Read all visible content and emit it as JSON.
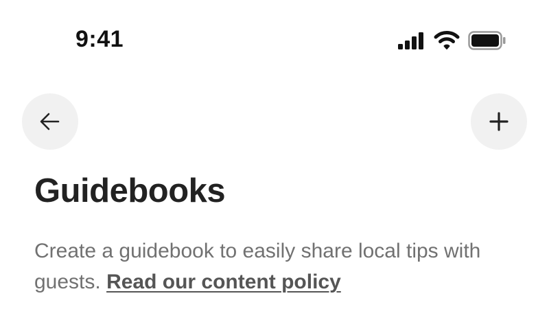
{
  "status_bar": {
    "time": "9:41",
    "icons": [
      "cellular-signal-icon",
      "wifi-icon",
      "battery-icon"
    ]
  },
  "navigation": {
    "back_icon": "arrow-left-icon",
    "add_icon": "plus-icon"
  },
  "page": {
    "title": "Guidebooks",
    "description_text": "Create a guidebook to easily share local tips with guests. ",
    "policy_link": "Read our content policy"
  },
  "colors": {
    "title": "#222222",
    "description": "#717171",
    "link": "#555555",
    "button_bg": "#f1f1f1"
  }
}
